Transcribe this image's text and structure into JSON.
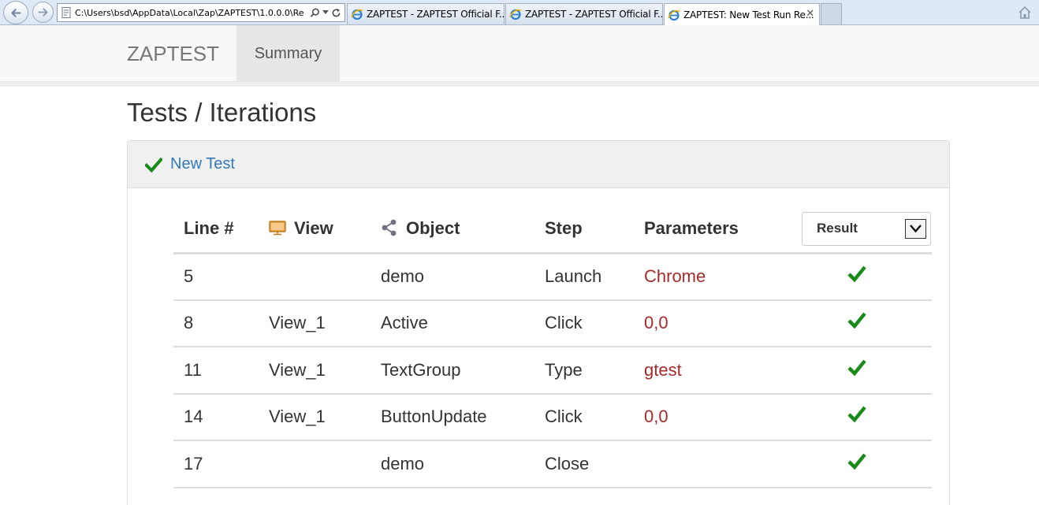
{
  "browser": {
    "address_url": "C:\\Users\\bsd\\AppData\\Local\\Zap\\ZAPTEST\\1.0.0.0\\Re",
    "tabs": [
      {
        "label": "ZAPTEST - ZAPTEST Official F...",
        "active": false
      },
      {
        "label": "ZAPTEST - ZAPTEST Official F...",
        "active": false
      },
      {
        "label": "ZAPTEST: New Test Run Re...",
        "active": true
      }
    ],
    "close_glyph": "✕"
  },
  "navbar": {
    "brand": "ZAPTEST",
    "summary_label": "Summary"
  },
  "page": {
    "title": "Tests / Iterations",
    "panel_title": "New Test"
  },
  "table": {
    "headers": {
      "line": "Line #",
      "view": "View",
      "object": "Object",
      "step": "Step",
      "parameters": "Parameters",
      "result": "Result"
    },
    "rows": [
      {
        "line": "5",
        "view": "",
        "object": "demo",
        "step": "Launch",
        "parameters": "Chrome",
        "result": "pass"
      },
      {
        "line": "8",
        "view": "View_1",
        "object": "Active",
        "step": "Click",
        "parameters": "0,0",
        "result": "pass"
      },
      {
        "line": "11",
        "view": "View_1",
        "object": "TextGroup",
        "step": "Type",
        "parameters": "gtest",
        "result": "pass"
      },
      {
        "line": "14",
        "view": "View_1",
        "object": "ButtonUpdate",
        "step": "Click",
        "parameters": "0,0",
        "result": "pass"
      },
      {
        "line": "17",
        "view": "",
        "object": "demo",
        "step": "Close",
        "parameters": "",
        "result": "pass"
      }
    ]
  },
  "colors": {
    "check_green": "#1a8a1a",
    "param_red": "#a52a2a",
    "link_blue": "#337ab7"
  },
  "icons": {
    "view": "monitor-icon",
    "object": "share-nodes-icon",
    "result": "check-icon"
  }
}
